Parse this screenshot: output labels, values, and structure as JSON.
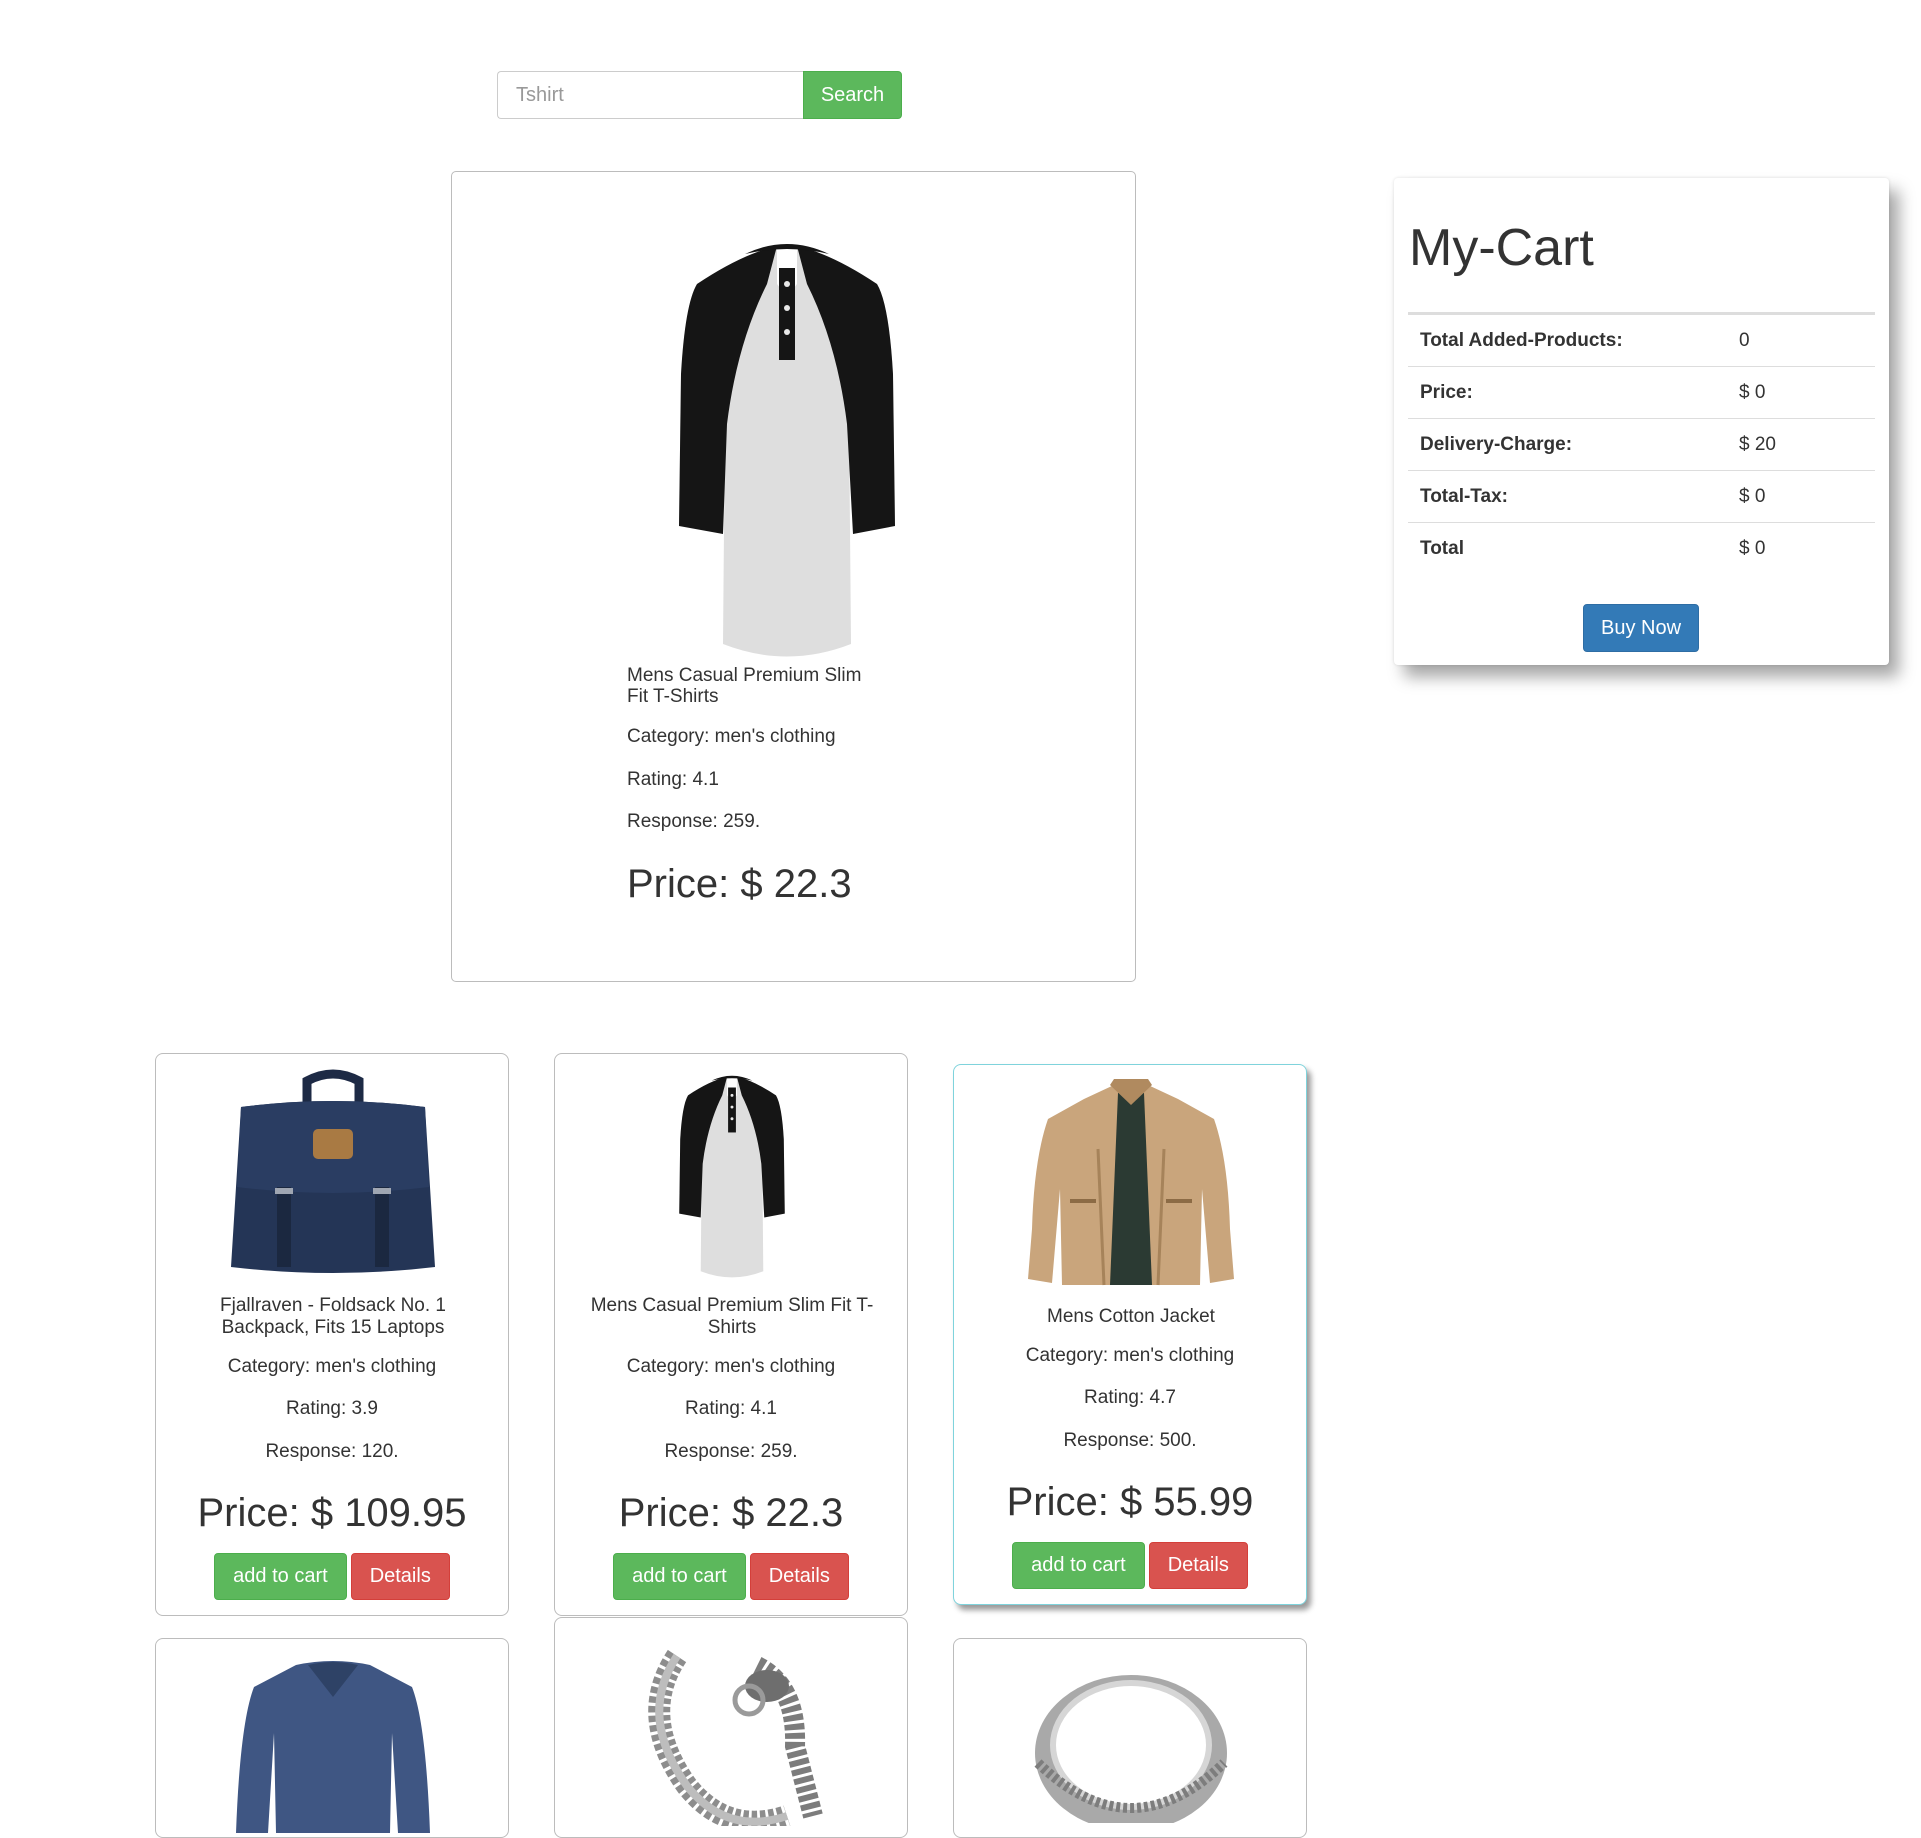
{
  "search": {
    "placeholder": "Tshirt",
    "button_label": "Search"
  },
  "featured": {
    "name": "Mens Casual Premium Slim Fit T-Shirts",
    "category": "Category: men's clothing",
    "rating": "Rating: 4.1",
    "response": "Response: 259.",
    "price": "Price: $ 22.3"
  },
  "cart": {
    "title": "My-Cart",
    "rows": [
      {
        "label": "Total Added-Products:",
        "value": "0"
      },
      {
        "label": "Price:",
        "value": "$ 0"
      },
      {
        "label": "Delivery-Charge:",
        "value": "$ 20"
      },
      {
        "label": "Total-Tax:",
        "value": "$ 0"
      },
      {
        "label": "Total",
        "value": "$ 0"
      }
    ],
    "buy_label": "Buy Now"
  },
  "products": [
    {
      "name": "Fjallraven - Foldsack No. 1 Backpack, Fits 15 Laptops",
      "category": "Category: men's clothing",
      "rating": "Rating: 3.9",
      "response": "Response: 120.",
      "price": "Price: $ 109.95",
      "add_label": "add to cart",
      "details_label": "Details"
    },
    {
      "name": "Mens Casual Premium Slim Fit T-Shirts",
      "category": "Category: men's clothing",
      "rating": "Rating: 4.1",
      "response": "Response: 259.",
      "price": "Price: $ 22.3",
      "add_label": "add to cart",
      "details_label": "Details"
    },
    {
      "name": "Mens Cotton Jacket",
      "category": "Category: men's clothing",
      "rating": "Rating: 4.7",
      "response": "Response: 500.",
      "price": "Price: $ 55.99",
      "add_label": "add to cart",
      "details_label": "Details"
    }
  ],
  "colors": {
    "success": "#5cb85c",
    "danger": "#d9534f",
    "primary": "#337ab7",
    "hover_border": "#7fd3dc"
  },
  "icons": {
    "featured_image": "raglan-henley-tshirt-image",
    "products": [
      "navy-backpack-image",
      "raglan-henley-tshirt-image",
      "khaki-cotton-jacket-image",
      "blue-vneck-longsleeve-image",
      "silver-dragon-bracelet-image",
      "silver-ring-image"
    ]
  }
}
